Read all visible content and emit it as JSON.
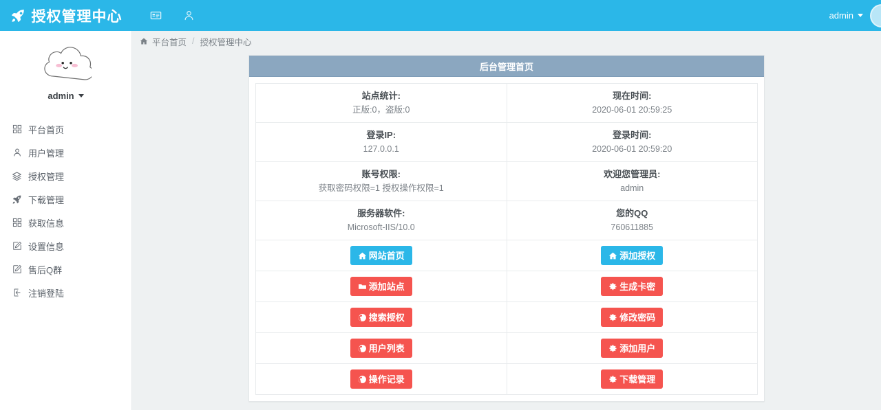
{
  "navbar": {
    "brand": "授权管理中心",
    "brand_icon": "rocket-icon",
    "icons": [
      {
        "name": "id-card-icon"
      },
      {
        "name": "user-icon"
      }
    ],
    "user": "admin",
    "avatar": "avatar-circle"
  },
  "sidebar": {
    "avatar_alt": "cloud-face-avatar",
    "user": "admin",
    "items": [
      {
        "label": "平台首页",
        "icon": "dashboard-icon"
      },
      {
        "label": "用户管理",
        "icon": "user-icon"
      },
      {
        "label": "授权管理",
        "icon": "layers-icon"
      },
      {
        "label": "下载管理",
        "icon": "rocket-icon"
      },
      {
        "label": "获取信息",
        "icon": "dashboard-icon"
      },
      {
        "label": "设置信息",
        "icon": "edit-icon"
      },
      {
        "label": "售后Q群",
        "icon": "edit-icon"
      },
      {
        "label": "注销登陆",
        "icon": "sign-out-icon"
      }
    ]
  },
  "breadcrumb": {
    "home_icon": "home-icon",
    "home": "平台首页",
    "separator": "/",
    "current": "授权管理中心"
  },
  "panel": {
    "title": "后台管理首页",
    "info_rows": [
      {
        "left": {
          "label": "站点统计:",
          "value": "正版:0，盗版:0"
        },
        "right": {
          "label": "现在时间:",
          "value": "2020-06-01 20:59:25"
        }
      },
      {
        "left": {
          "label": "登录IP:",
          "value": "127.0.0.1"
        },
        "right": {
          "label": "登录时间:",
          "value": "2020-06-01 20:59:20"
        }
      },
      {
        "left": {
          "label": "账号权限:",
          "value": "获取密码权限=1 授权操作权限=1"
        },
        "right": {
          "label": "欢迎您管理员:",
          "value": "admin"
        }
      },
      {
        "left": {
          "label": "服务器软件:",
          "value": "Microsoft-IIS/10.0"
        },
        "right": {
          "label": "您的QQ",
          "value": "760611885"
        }
      }
    ],
    "button_rows": [
      {
        "left": {
          "label": "网站首页",
          "icon": "home-icon",
          "style": "blue"
        },
        "right": {
          "label": "添加授权",
          "icon": "home-icon",
          "style": "blue"
        }
      },
      {
        "left": {
          "label": "添加站点",
          "icon": "folder-icon",
          "style": "red"
        },
        "right": {
          "label": "生成卡密",
          "icon": "gear-icon",
          "style": "red"
        }
      },
      {
        "left": {
          "label": "搜索授权",
          "icon": "globe-icon",
          "style": "red"
        },
        "right": {
          "label": "修改密码",
          "icon": "gear-icon",
          "style": "red"
        }
      },
      {
        "left": {
          "label": "用户列表",
          "icon": "globe-icon",
          "style": "red"
        },
        "right": {
          "label": "添加用户",
          "icon": "gear-icon",
          "style": "red"
        }
      },
      {
        "left": {
          "label": "操作记录",
          "icon": "globe-icon",
          "style": "red"
        },
        "right": {
          "label": "下载管理",
          "icon": "gear-icon",
          "style": "red"
        }
      }
    ]
  },
  "colors": {
    "navbar": "#2bb7e8",
    "panel_header": "#8ba7c0",
    "button_blue": "#2bb7e8",
    "button_red": "#f5544f",
    "page_bg": "#eef1f2"
  }
}
